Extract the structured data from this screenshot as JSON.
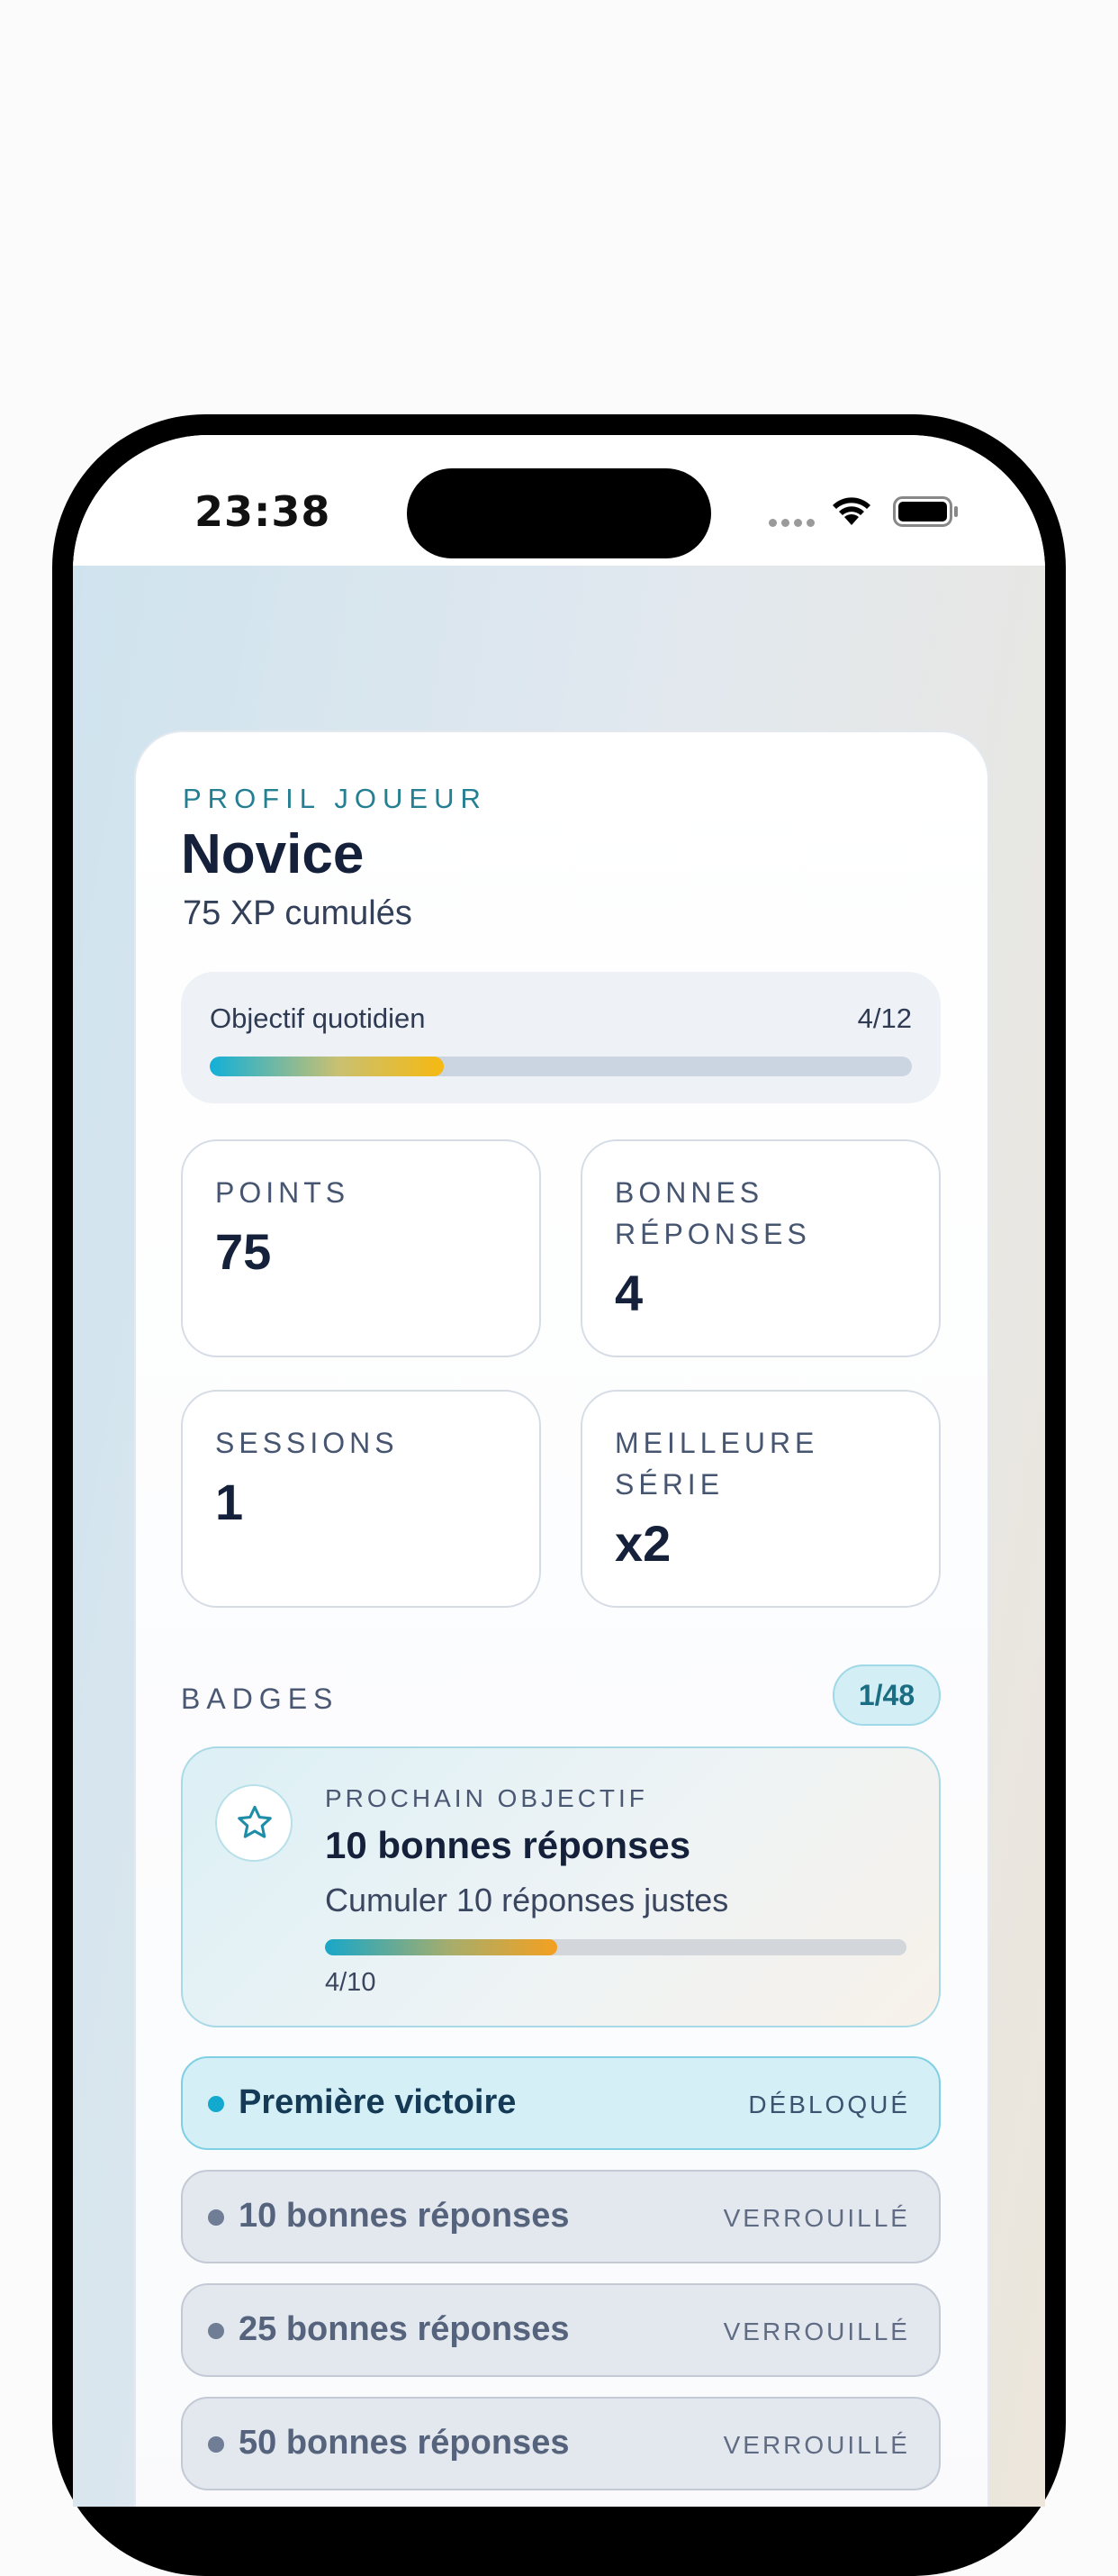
{
  "status_bar": {
    "time": "23:38"
  },
  "profile": {
    "eyebrow": "PROFIL JOUEUR",
    "title": "Novice",
    "xp": "75 XP cumulés"
  },
  "daily_goal": {
    "label": "Objectif quotidien",
    "count": "4/12",
    "progress": 0.333
  },
  "stats": [
    {
      "label": "POINTS",
      "value": "75"
    },
    {
      "label": "BONNES RÉPONSES",
      "value": "4"
    },
    {
      "label": "SESSIONS",
      "value": "1"
    },
    {
      "label": "MEILLEURE SÉRIE",
      "value": "x2"
    }
  ],
  "badges": {
    "heading": "BADGES",
    "count": "1/48",
    "next_goal": {
      "eyebrow": "PROCHAIN OBJECTIF",
      "title": "10 bonnes réponses",
      "description": "Cumuler 10 réponses justes",
      "count": "4/10",
      "progress": 0.4,
      "icon": "star-icon"
    },
    "items": [
      {
        "name": "Première victoire",
        "status": "DÉBLOQUÉ",
        "state": "unlocked"
      },
      {
        "name": "10 bonnes réponses",
        "status": "VERROUILLÉ",
        "state": "locked"
      },
      {
        "name": "25 bonnes réponses",
        "status": "VERROUILLÉ",
        "state": "locked"
      },
      {
        "name": "50 bonnes réponses",
        "status": "VERROUILLÉ",
        "state": "locked"
      }
    ]
  },
  "colors": {
    "accent": "#12a9cf",
    "text_dark": "#15213a",
    "eyebrow": "#247f92"
  }
}
